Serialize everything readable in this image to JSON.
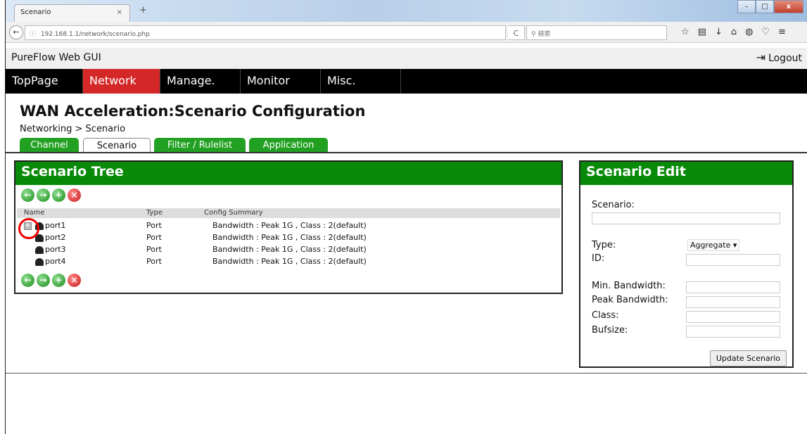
{
  "browser": {
    "tab_title": "Scenario",
    "tab_close": "×",
    "new_tab": "+",
    "url": "192.168.1.1/network/scenario.php",
    "search_placeholder": "検索",
    "reload": "C",
    "back": "←"
  },
  "app": {
    "title": "PureFlow Web GUI",
    "logout": "Logout"
  },
  "menu": {
    "items": [
      "TopPage",
      "Network",
      "Manage.",
      "Monitor",
      "Misc."
    ],
    "active": "Network"
  },
  "page": {
    "title": "WAN Acceleration:Scenario Configuration",
    "breadcrumb": "Networking > Scenario"
  },
  "tabs": {
    "items": [
      "Channel",
      "Scenario",
      "Filter / Rulelist",
      "Application"
    ],
    "active": "Scenario"
  },
  "tree": {
    "title": "Scenario Tree",
    "columns": [
      "Name",
      "Type",
      "Config Summary"
    ],
    "rows": [
      {
        "name": "port1",
        "type": "Port",
        "summary": "Bandwidth : Peak 1G , Class : 2(default)"
      },
      {
        "name": "port2",
        "type": "Port",
        "summary": "Bandwidth : Peak 1G , Class : 2(default)"
      },
      {
        "name": "port3",
        "type": "Port",
        "summary": "Bandwidth : Peak 1G , Class : 2(default)"
      },
      {
        "name": "port4",
        "type": "Port",
        "summary": "Bandwidth : Peak 1G , Class : 2(default)"
      }
    ]
  },
  "edit": {
    "title": "Scenario Edit",
    "scenario_label": "Scenario:",
    "type_label": "Type:",
    "type_value": "Aggregate",
    "id_label": "ID:",
    "min_bw_label": "Min. Bandwidth:",
    "peak_bw_label": "Peak Bandwidth:",
    "class_label": "Class:",
    "bufsize_label": "Bufsize:",
    "update_button": "Update Scenario"
  },
  "colors": {
    "panel_header": "#088a08",
    "tab_green": "#21a021",
    "menu_active": "#d42828",
    "menu_bg": "#000000"
  }
}
